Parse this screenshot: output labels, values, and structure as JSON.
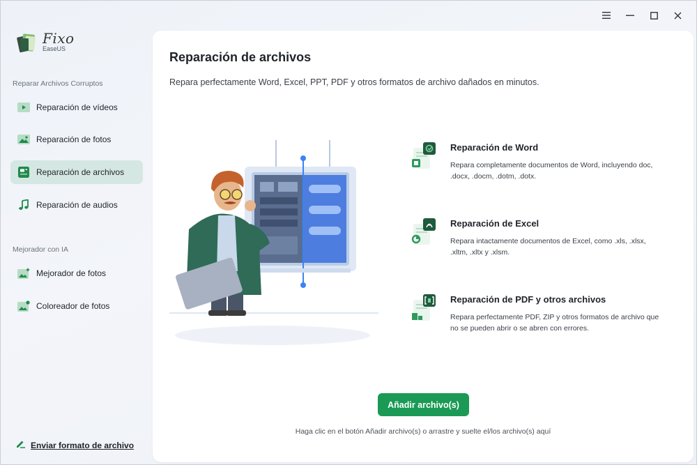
{
  "window": {
    "controls": [
      {
        "name": "menu-icon"
      },
      {
        "name": "minimize-icon"
      },
      {
        "name": "maximize-icon"
      },
      {
        "name": "close-icon"
      }
    ]
  },
  "brand": {
    "name": "Fixo",
    "sub": "EaseUS"
  },
  "sidebar": {
    "section_repair": "Reparar Archivos Corruptos",
    "section_enhance": "Mejorador con IA",
    "items": [
      {
        "label": "Reparación de vídeos",
        "icon": "video-icon",
        "active": false
      },
      {
        "label": "Reparación de fotos",
        "icon": "photo-icon",
        "active": false
      },
      {
        "label": "Reparación de archivos",
        "icon": "file-icon",
        "active": true
      },
      {
        "label": "Reparación de audios",
        "icon": "music-icon",
        "active": false
      },
      {
        "label": "Mejorador de fotos",
        "icon": "photo-enhance-icon",
        "active": false
      },
      {
        "label": "Coloreador de fotos",
        "icon": "photo-color-icon",
        "active": false
      }
    ],
    "feedback": "Enviar formato de archivo"
  },
  "main": {
    "title": "Reparación de archivos",
    "subtitle": "Repara perfectamente Word, Excel, PPT, PDF y otros formatos de archivo dañados en minutos.",
    "features": [
      {
        "title": "Reparación de Word",
        "desc": "Repara completamente documentos de Word, incluyendo doc, .docx, .docm, .dotm, .dotx.",
        "icon": "word-icon"
      },
      {
        "title": "Reparación de Excel",
        "desc": "Repara intactamente documentos de Excel, como .xls, .xlsx, .xltm, .xltx y .xlsm.",
        "icon": "excel-icon"
      },
      {
        "title": "Reparación de PDF y otros archivos",
        "desc": "Repara perfectamente PDF, ZIP y otros formatos de archivo que no se pueden abrir o se abren con errores.",
        "icon": "pdf-icon"
      }
    ],
    "add_button": "Añadir archivo(s)",
    "hint": "Haga clic en el botón Añadir archivo(s) o arrastre y suelte el/los archivo(s) aquí"
  },
  "colors": {
    "accent": "#1a9a54",
    "active_nav": "#d5e7e3",
    "icon_green": "#2e9a5c",
    "icon_dark": "#1f5b3d"
  }
}
